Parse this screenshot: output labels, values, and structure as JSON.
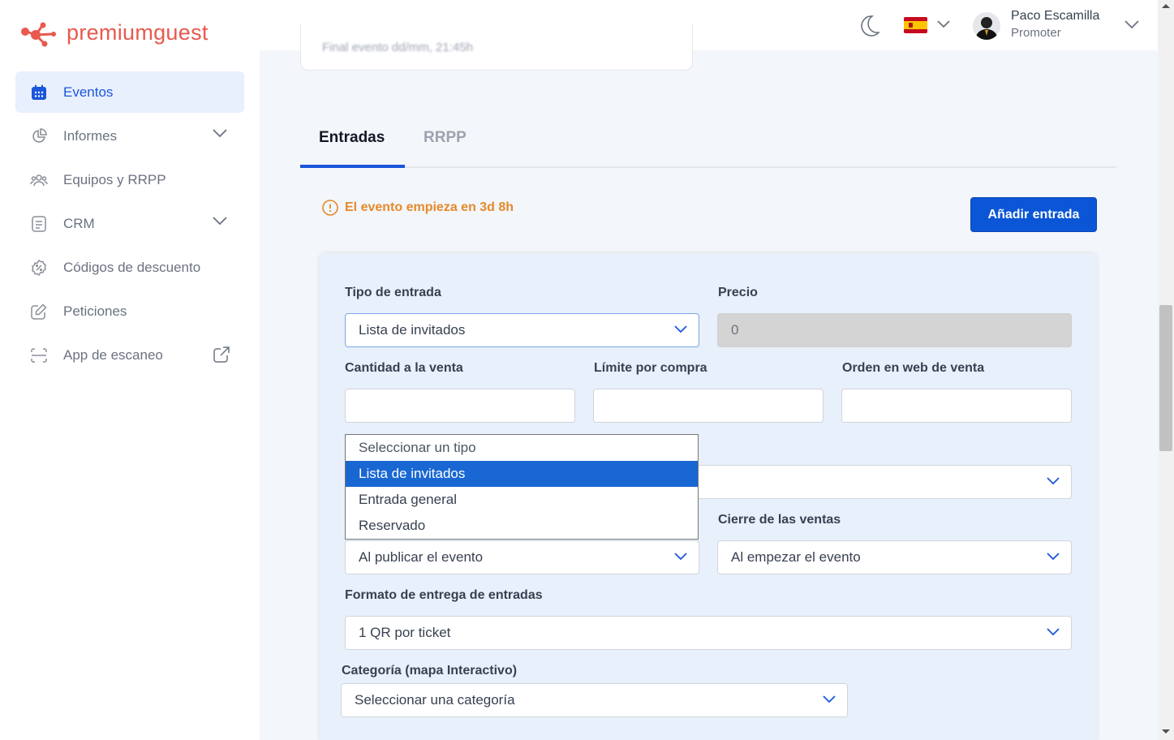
{
  "brand": {
    "name": "premiumguest",
    "color": "#e8594e"
  },
  "sidebar": {
    "items": [
      {
        "label": "Eventos",
        "icon": "calendar-icon",
        "active": true
      },
      {
        "label": "Informes",
        "icon": "pie-chart-icon",
        "expandable": true
      },
      {
        "label": "Equipos y RRPP",
        "icon": "users-icon"
      },
      {
        "label": "CRM",
        "icon": "document-icon",
        "expandable": true
      },
      {
        "label": "Códigos de descuento",
        "icon": "discount-icon"
      },
      {
        "label": "Peticiones",
        "icon": "edit-icon"
      },
      {
        "label": "App de escaneo",
        "icon": "scan-icon",
        "external": true
      }
    ]
  },
  "header": {
    "user_name": "Paco Escamilla",
    "user_role": "Promoter",
    "language_flag": "spain-flag-icon"
  },
  "prev_card": {
    "text": "Final evento dd/mm, 21:45h"
  },
  "tabs": [
    {
      "label": "Entradas",
      "active": true
    },
    {
      "label": "RRPP",
      "active": false
    }
  ],
  "notice": {
    "text": "El evento empieza en 3d 8h",
    "color": "#e5892b"
  },
  "add_button": {
    "label": "Añadir entrada",
    "color": "#0b56d6"
  },
  "form": {
    "tipo_label": "Tipo de entrada",
    "tipo_value": "Lista de invitados",
    "precio_label": "Precio",
    "precio_value": "0",
    "cantidad_label": "Cantidad a la venta",
    "limite_label": "Límite por compra",
    "orden_label": "Orden en web de venta",
    "apertura_value": "Al publicar el evento",
    "cierre_label": "Cierre de las ventas",
    "cierre_value": "Al empezar el evento",
    "formato_label": "Formato de entrega de entradas",
    "formato_value": "1 QR por ticket",
    "categoria_label": "Categoría (mapa Interactivo)",
    "categoria_value": "Seleccionar una categoría"
  },
  "dropdown": {
    "options": [
      "Seleccionar un tipo",
      "Lista de invitados",
      "Entrada general",
      "Reservado"
    ],
    "selected": "Lista de invitados"
  }
}
